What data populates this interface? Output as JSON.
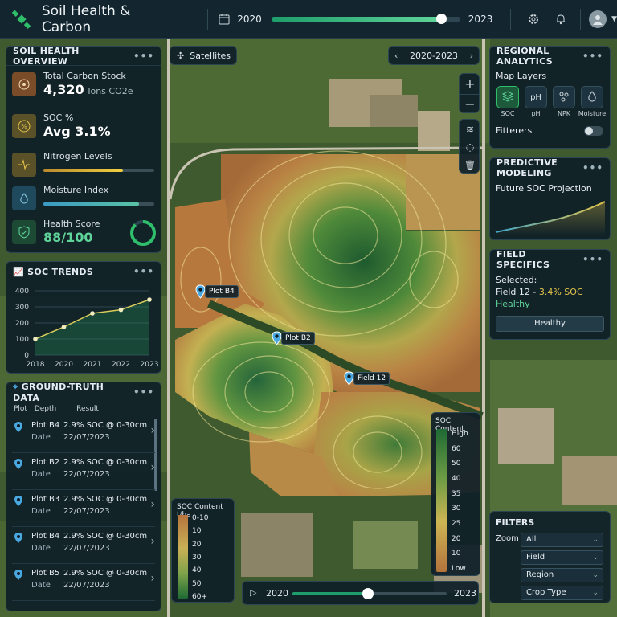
{
  "app": {
    "title": "Soil Health & Carbon"
  },
  "top_timeline": {
    "start": "2020",
    "end": "2023",
    "position": 0.9
  },
  "soil_overview": {
    "title": "SOIL HEALTH OVERVIEW",
    "carbon": {
      "label": "Total Carbon Stock",
      "value": "4,320",
      "unit": "Tons CO2e"
    },
    "soc": {
      "label": "SOC %",
      "value": "Avg 3.1%"
    },
    "nitrogen": {
      "label": "Nitrogen Levels",
      "level": 0.72
    },
    "moisture": {
      "label": "Moisture Index",
      "level": 0.86
    },
    "health": {
      "label": "Health Score",
      "value": "88/100",
      "score": 0.88
    }
  },
  "soc_trends": {
    "title": "SOC TRENDS"
  },
  "chart_data": {
    "type": "area",
    "title": "SOC TRENDS",
    "x": [
      "2018",
      "2020",
      "2021",
      "2022",
      "2023"
    ],
    "values": [
      100,
      175,
      260,
      282,
      345
    ],
    "yticks": [
      "400",
      "300",
      "200",
      "100",
      "0"
    ],
    "ylim": [
      0,
      400
    ],
    "grid": true
  },
  "ground_truth": {
    "title": "GROUND-TRUTH DATA",
    "columns": [
      "Plot",
      "Depth",
      "Result"
    ],
    "date_label": "Date",
    "rows": [
      {
        "plot": "Plot B4",
        "result": "2.9% SOC @ 0-30cm",
        "date": "22/07/2023"
      },
      {
        "plot": "Plot B2",
        "result": "2.9% SOC @ 0-30cm",
        "date": "22/07/2023"
      },
      {
        "plot": "Plot B3",
        "result": "2.9% SOC @ 0-30cm",
        "date": "22/07/2023"
      },
      {
        "plot": "Plot B4",
        "result": "2.9% SOC @ 0-30cm",
        "date": "22/07/2023"
      },
      {
        "plot": "Plot B5",
        "result": "2.9% SOC @ 0-30cm",
        "date": "22/07/2023"
      }
    ]
  },
  "map": {
    "satellites_label": "Satellites",
    "date_range": "2020-2023",
    "pins": [
      {
        "label": "Plot B4"
      },
      {
        "label": "Plot B2"
      },
      {
        "label": "Field 12"
      }
    ],
    "legend_left": {
      "title": "SOC Content t/ha",
      "labels": [
        "0-10",
        "10",
        "20",
        "30",
        "40",
        "50",
        "60+"
      ]
    },
    "legend_right": {
      "title": "SOC Content",
      "labels": [
        "High",
        "60",
        "50",
        "40",
        "35",
        "30",
        "25",
        "20",
        "10",
        "Low"
      ]
    },
    "bottom_timeline": {
      "start": "2020",
      "end": "2023",
      "position": 0.49
    }
  },
  "regional": {
    "title": "REGIONAL ANALYTICS",
    "map_layers_label": "Map Layers",
    "layers": [
      {
        "label": "SOC",
        "icon": "layers-icon",
        "active": true
      },
      {
        "label": "pH",
        "icon": "ph-text",
        "glyph": "pH",
        "active": false
      },
      {
        "label": "NPK",
        "icon": "molecule-icon",
        "active": false
      },
      {
        "label": "Moisture",
        "icon": "droplet-icon",
        "active": false
      }
    ],
    "filters_toggle_label": "Fitterers",
    "filters_toggle_on": false
  },
  "predictive": {
    "title": "PREDICTIVE MODELING",
    "subtitle": "Future SOC Projection"
  },
  "field_specifics": {
    "title": "FIELD SPECIFICS",
    "selected_label": "Selected:",
    "field_name": "Field 12",
    "field_soc": "3.4% SOC",
    "status": "Healthy",
    "button": "Healthy"
  },
  "filters": {
    "title": "FILTERS",
    "zoom_label": "Zoom",
    "selects": [
      "All",
      "Field",
      "Region",
      "Crop Type"
    ]
  },
  "colors": {
    "accent_green": "#1e9e6a",
    "carbon_brown": "#7a4c28",
    "soc_yellow": "#e3c34a",
    "health_green": "#2fbf6a"
  }
}
